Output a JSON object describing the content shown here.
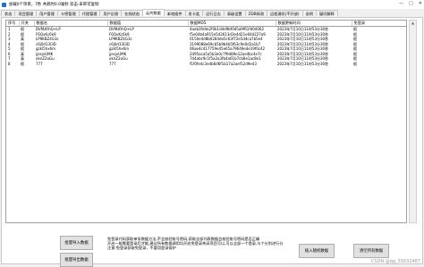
{
  "window": {
    "title": "加载0个项目，7秒 共耗时0.0毫秒    双击-未审可复制",
    "controls": [
      "—",
      "□",
      "✕"
    ]
  },
  "tabs": [
    {
      "label": "状态",
      "active": false
    },
    {
      "label": "项目管理",
      "active": false
    },
    {
      "label": "用户管理",
      "active": false
    },
    {
      "label": "卡密管理",
      "active": false
    },
    {
      "label": "代理管理",
      "active": false
    },
    {
      "label": "用户反馈",
      "active": false
    },
    {
      "label": "在线状态",
      "active": false
    },
    {
      "label": "云共数据",
      "active": true
    },
    {
      "label": "本地插件",
      "active": false
    },
    {
      "label": "发卡类",
      "active": false
    },
    {
      "label": "运行日志",
      "active": false
    },
    {
      "label": "高级设置",
      "active": false
    },
    {
      "label": "ZDB探测",
      "active": false
    },
    {
      "label": "远程通讯(不开放)",
      "active": false
    },
    {
      "label": "说明",
      "active": false
    },
    {
      "label": "疑问解释",
      "active": false
    }
  ],
  "table": {
    "columns": [
      "序号",
      "开关",
      "数据名",
      "数据值",
      "数据MD5",
      "数据更新时间",
      "免登录"
    ],
    "rows": [
      [
        "1",
        "假",
        "DVMzRhQ+LP",
        "DVMzRhQ+LP",
        "4aeb3fd4e2f0b1d4d9bf0d5a9f61fd04062",
        "2023年7月10日11时53分30秒",
        "假"
      ],
      [
        "2",
        "假",
        "F6QvKc6k9",
        "F6QvKc6k9",
        "f5e04b4a915e5d2613d3e4d21e04d227a9",
        "2023年7月10日11时53分30秒",
        "假"
      ],
      [
        "3",
        "真",
        "LP9KBZ4G3c",
        "LP9KBZ4G3c",
        "0150e4d8b0284da5c63f72e5d4ca7b5e4",
        "2023年7月10日11时53分30秒",
        "假"
      ],
      [
        "4",
        "假",
        "c6j0d13I3D",
        "c6j0d13I3D",
        "3199088e69cb5b9b4b5f63c9e0d2a1b7",
        "2023年7月10日11时53分30秒",
        "假"
      ],
      [
        "5",
        "假",
        "gzkI5hx6m",
        "gzkI5hx6m",
        "06ae4c417759e45e65a79649e4e19f0c42",
        "2023年7月10日11时53分30秒",
        "假"
      ],
      [
        "6",
        "真",
        "jjesjxUMK",
        "jjesjxUMK",
        "2d95aca5a5b3e0c7f9d89e12ae4bc4e7c",
        "2023年7月10日11时53分30秒",
        "假"
      ],
      [
        "7",
        "真",
        "oknZ2oGu",
        "oknZ2oGu",
        "7d4abc9c1f5a2a3fb4a61b7cb8e1ac8e1",
        "2023年7月10日11时53分30秒",
        "假"
      ],
      [
        "8",
        "假",
        "777",
        "777",
        "f1f0fe4c3e4b6d6f1b17a2aef12d9e43",
        "2023年7月10日11时53分30秒",
        "假"
      ]
    ]
  },
  "buttons": {
    "batch_import": "批量导入数据",
    "batch_export": "批量导出数据",
    "insert_random": "插入随机数据",
    "clear_all": "清空所有数据"
  },
  "notice": {
    "line1": "免登录代码获取单条数据方法,不会校验账号密码,获取全部列表数据会校验账号密码是否正确",
    "line2": "开启一般需要登录后才能,建议所有数据调用均开启免登录关闭项目可以,可以全部一个登录,与个分别进行分",
    "line3": "注意:免登录获取免登录，不要用登录保护"
  },
  "watermark": "CSDN @qq_35632487"
}
